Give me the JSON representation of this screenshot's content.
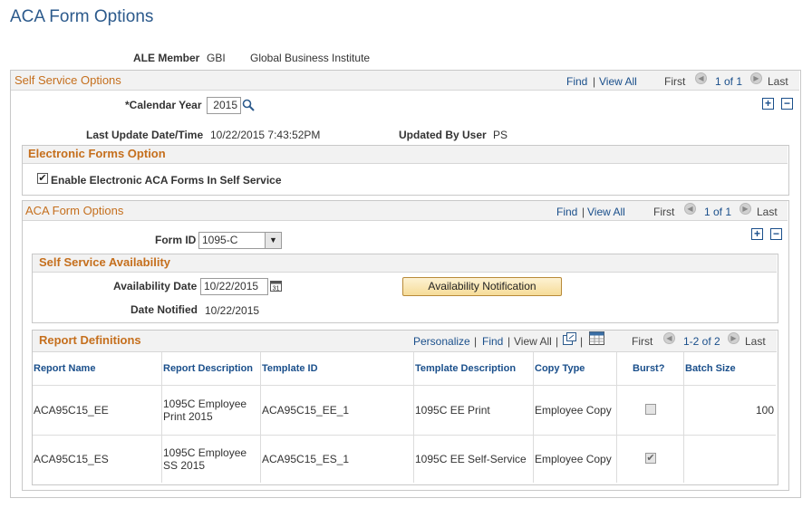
{
  "page": {
    "title": "ACA Form Options"
  },
  "ale": {
    "label": "ALE Member",
    "code": "GBI",
    "name": "Global Business Institute"
  },
  "self_service": {
    "title": "Self Service Options",
    "nav": {
      "find": "Find",
      "view_all": "View All",
      "first": "First",
      "count": "1 of 1",
      "last": "Last"
    },
    "calendar_year": {
      "label": "*Calendar Year",
      "value": "2015"
    },
    "last_update": {
      "label": "Last Update Date/Time",
      "value": "10/22/2015  7:43:52PM"
    },
    "updated_by": {
      "label": "Updated By User",
      "value": "PS"
    }
  },
  "electronic": {
    "title": "Electronic Forms Option",
    "enable_label": "Enable Electronic ACA Forms In Self Service",
    "enabled": "✔"
  },
  "aca_form": {
    "title": "ACA Form Options",
    "nav": {
      "find": "Find",
      "view_all": "View All",
      "first": "First",
      "count": "1 of 1",
      "last": "Last"
    },
    "form_id": {
      "label": "Form ID",
      "value": "1095-C"
    }
  },
  "availability": {
    "title": "Self Service Availability",
    "date_label": "Availability Date",
    "date_value": "10/22/2015",
    "button": "Availability Notification",
    "notified_label": "Date Notified",
    "notified_value": "10/22/2015"
  },
  "reports": {
    "title": "Report Definitions",
    "nav": {
      "personalize": "Personalize",
      "find": "Find",
      "view_all": "View All",
      "first": "First",
      "count": "1-2 of 2",
      "last": "Last"
    },
    "columns": [
      "Report Name",
      "Report Description",
      "Template ID",
      "Template Description",
      "Copy Type",
      "Burst?",
      "Batch Size"
    ],
    "rows": [
      {
        "name": "ACA95C15_EE",
        "desc1": "1095C Employee",
        "desc2": "Print 2015",
        "template_id": "ACA95C15_EE_1",
        "template_desc": "1095C EE Print",
        "copy_type": "Employee Copy",
        "burst": "",
        "batch": "100"
      },
      {
        "name": "ACA95C15_ES",
        "desc1": "1095C Employee",
        "desc2": "SS 2015",
        "template_id": "ACA95C15_ES_1",
        "template_desc": "1095C EE Self-Service",
        "copy_type": "Employee Copy",
        "burst": "✔",
        "batch": ""
      }
    ]
  }
}
